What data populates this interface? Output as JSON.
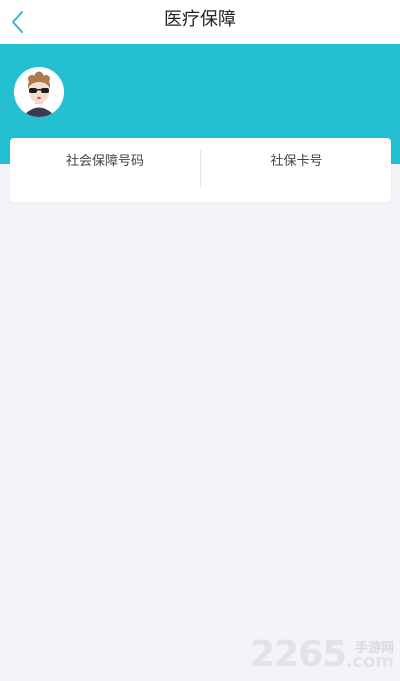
{
  "nav": {
    "title": "医疗保障",
    "back_icon": "chevron-left-icon"
  },
  "colors": {
    "accent": "#25bfd2",
    "background": "#f3f4f8",
    "back_icon": "#3ab4d0"
  },
  "profile": {
    "avatar_icon": "user-avatar-sunglasses"
  },
  "card": {
    "social_security_number_label": "社会保障号码",
    "social_security_number_value": "",
    "social_security_card_label": "社保卡号",
    "social_security_card_value": ""
  },
  "watermark": {
    "number": "2265",
    "suffix": "手游网",
    "domain": ".com"
  }
}
